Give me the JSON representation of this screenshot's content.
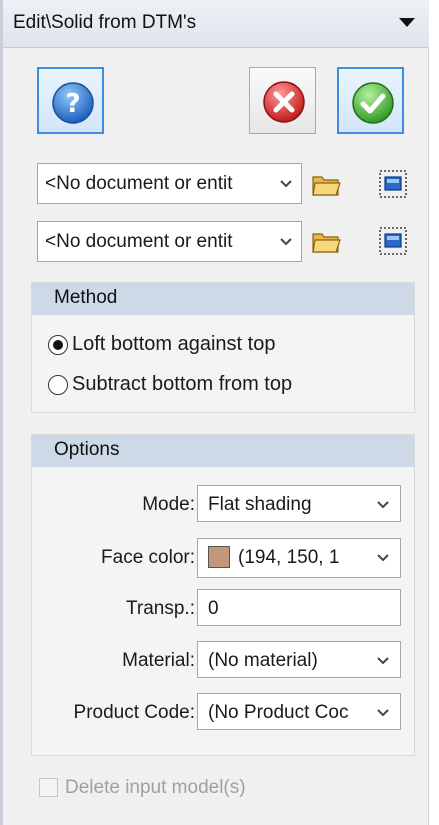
{
  "window": {
    "title": "Edit\\Solid from DTM's"
  },
  "toolbar": {
    "help_icon": "help-icon",
    "cancel_icon": "cancel-icon",
    "ok_icon": "ok-check-icon"
  },
  "inputs": [
    {
      "value": "<No document or entit",
      "browse_icon": "folder-icon",
      "pick_icon": "select-window-icon"
    },
    {
      "value": "<No document or entit",
      "browse_icon": "folder-icon",
      "pick_icon": "select-window-icon"
    }
  ],
  "method": {
    "header": "Method",
    "options": [
      {
        "label": "Loft bottom against top",
        "selected": true
      },
      {
        "label": "Subtract bottom from top",
        "selected": false
      }
    ]
  },
  "options": {
    "header": "Options",
    "mode": {
      "label": "Mode:",
      "value": "Flat shading"
    },
    "face_color": {
      "label": "Face color:",
      "value": "(194, 150, 1",
      "color": "#c29678"
    },
    "transparency": {
      "label": "Transp.:",
      "value": "0"
    },
    "material": {
      "label": "Material:",
      "value": "(No material)"
    },
    "product_code": {
      "label": "Product Code:",
      "value": "(No Product Coc"
    }
  },
  "delete_input": {
    "label": "Delete input model(s)",
    "checked": false,
    "enabled": false
  }
}
